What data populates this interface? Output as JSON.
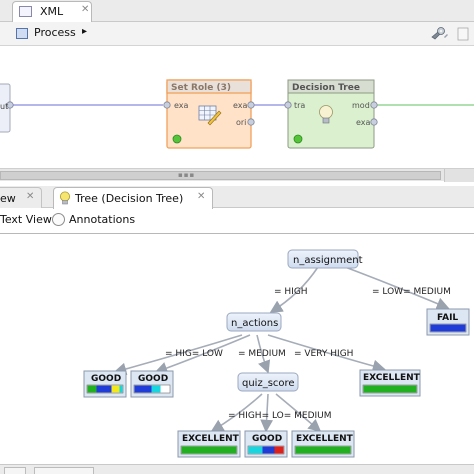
{
  "top_tabs": {
    "xml_label": "XML",
    "close": "✕"
  },
  "toolbar": {
    "process_label": "Process",
    "process_arrow": "▸"
  },
  "process": {
    "ports_partial": {
      "out": "ut"
    },
    "set_role": {
      "title": "Set Role (3)",
      "in_port": "exa",
      "out_ports": [
        "exa",
        "ori"
      ]
    },
    "decision_tree": {
      "title": "Decision Tree",
      "in_port": "tra",
      "out_ports": [
        "mod",
        "exa"
      ]
    }
  },
  "bottom_tabs": {
    "view_label": "ew",
    "tree_label": "Tree (Decision Tree)",
    "close": "✕"
  },
  "view_options": {
    "text_view": "Text View",
    "annotations": "Annotations"
  },
  "tree": {
    "root": "n_assignment",
    "root_edges": [
      "= HIGH",
      "= LOW= MEDIUM"
    ],
    "n_actions": "n_actions",
    "n_actions_edges": [
      "= HIG= LOW",
      "= MEDIUM",
      "= VERY HIGH"
    ],
    "quiz_score": "quiz_score",
    "quiz_edges": [
      "= HIGH= LO= MEDIUM"
    ],
    "leaves": {
      "fail": "FAIL",
      "good1": "GOOD",
      "good2": "GOOD",
      "excellent1": "EXCELLENT",
      "excellent2": "EXCELLENT",
      "good3": "GOOD",
      "excellent3": "EXCELLENT"
    }
  },
  "colors": {
    "set_role_fill": "#ffe2c7",
    "decision_tree_fill": "#daf0cf",
    "node_fill": "#dbe6f5",
    "bar_green": "#20b020",
    "bar_blue": "#1f3bd8",
    "bar_yellow": "#f4e71a",
    "bar_cyan": "#18d6e0",
    "bar_red": "#e0201b"
  }
}
